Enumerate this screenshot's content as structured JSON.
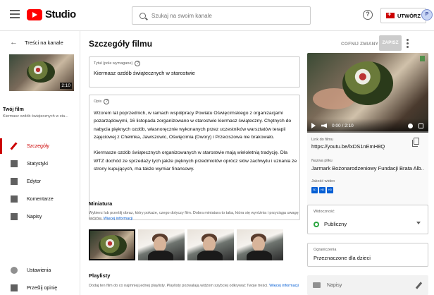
{
  "app": {
    "logo_text": "Studio"
  },
  "search": {
    "placeholder": "Szukaj na swoim kanale"
  },
  "header": {
    "help": "?",
    "create_label": "UTWÓRZ",
    "avatar_letter": "P"
  },
  "sidebar": {
    "back_label": "Treści na kanale",
    "thumb_duration": "2:10",
    "your_film_label": "Twój film",
    "your_film_title": "Kiermasz ozdób świątecznych w sta...",
    "nav": [
      {
        "label": "Szczegóły"
      },
      {
        "label": "Statystyki"
      },
      {
        "label": "Edytor"
      },
      {
        "label": "Komentarze"
      },
      {
        "label": "Napisy"
      }
    ],
    "bottom": [
      {
        "label": "Ustawienia"
      },
      {
        "label": "Prześlij opinię"
      }
    ]
  },
  "main": {
    "title": "Szczegóły filmu",
    "undo_label": "COFNIJ ZMIANY",
    "save_label": "ZAPISZ",
    "title_field": {
      "label": "Tytuł (pole wymagane)",
      "value": "Kiermasz ozdób świątecznych w starostwie"
    },
    "description_field": {
      "label": "Opis",
      "p1": "Wzorem lat poprzednich, w ramach współpracy Powiatu Oświęcimskiego z organizacjami pozarządowymi, 16 listopada zorganizowano w starostwie kiermasz świąteczny. Chętnych do nabycia pięknych ozdób, własnoręcznie wykonanych przez uczestników warsztatów terapii zajęciowej z Chełmka, Jawiszowic, Oświęcimia (Dwory) i Przeciszowa nie brakowało.",
      "p2": "Kiermasze ozdób świątecznych organizowanych w starostwie mają wieloletnią tradycję. Dla WTZ dochód ze sprzedaży tych jakże pięknych przedmiotów oprócz słów zachwytu i uznania ze strony kupujących, ma także wymiar finansowy."
    },
    "thumbnail": {
      "title": "Miniatura",
      "text": "Wybierz lub prześlij obraz, który pokaże, czego dotyczy film. Dobra miniatura to taka, która się wyróżnia i przyciąga uwagę widzów.",
      "link": "Więcej informacji"
    },
    "playlists": {
      "title": "Playlisty",
      "text": "Dodaj ten film do co najmniej jednej playlisty. Playlisty pozwalają widzom szybciej odkrywać Twoje treści.",
      "link": "Więcej informacji"
    }
  },
  "right": {
    "video_time": "0:00 / 2:10",
    "link_label": "Link do filmu",
    "link_value": "https://youtu.be/lxDS1nEmH8Q",
    "file_label": "Nazwa pliku",
    "file_value": "Jarmark Bożonarodzeniowy Fundacji Brata Alb...",
    "quality_label": "Jakość wideo",
    "quality_badges": [
      "SD",
      "HD",
      "HD"
    ],
    "visibility": {
      "label": "Widoczność",
      "value": "Publiczny"
    },
    "restrictions": {
      "label": "Ograniczenia",
      "value": "Przeznaczone dla dzieci"
    },
    "subtitles_label": "Napisy"
  },
  "colors": {
    "accent": "#cc0000",
    "link": "#065fd4",
    "public": "#2ba640"
  }
}
